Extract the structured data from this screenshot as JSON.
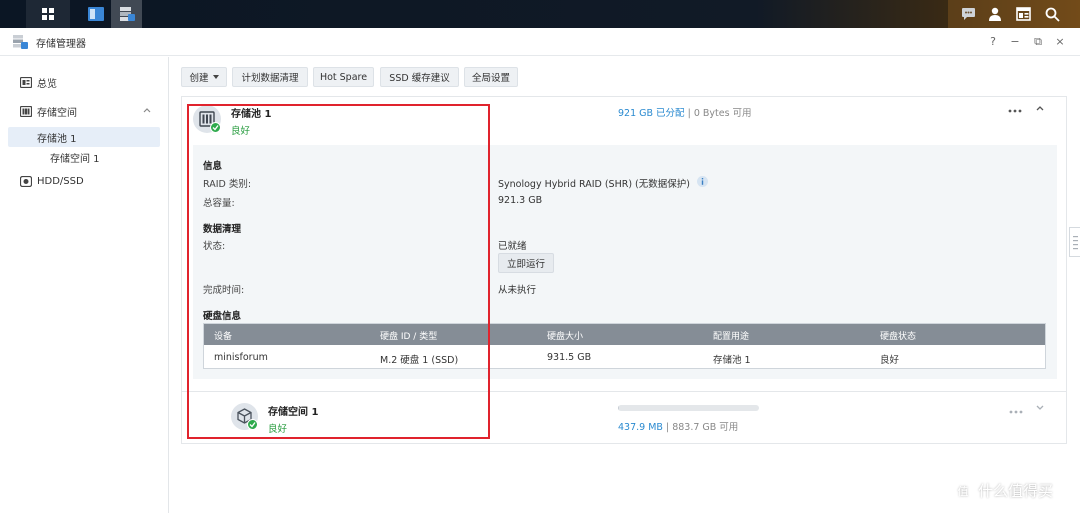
{
  "window": {
    "title": "存储管理器",
    "controls": [
      "?",
      "−",
      "⧉",
      "×"
    ]
  },
  "sidebar": {
    "items": [
      {
        "label": "总览"
      },
      {
        "label": "存储空间"
      },
      {
        "label": "存储池 1"
      },
      {
        "label": "存储空间 1"
      },
      {
        "label": "HDD/SSD"
      }
    ]
  },
  "toolbar": {
    "create_label": "创建",
    "scrub_label": "计划数据清理",
    "hotspare_label": "Hot Spare",
    "ssd_cache_label": "SSD 缓存建议",
    "global_label": "全局设置"
  },
  "pool": {
    "name": "存储池 1",
    "status": "良好",
    "allocated": "921 GB 已分配",
    "separator": " | ",
    "available": "0 Bytes 可用",
    "info_heading": "信息",
    "raid_label": "RAID 类别:",
    "raid_value": "Synology Hybrid RAID (SHR) (无数据保护)",
    "capacity_label": "总容量:",
    "capacity_value": "921.3 GB",
    "scrub_heading": "数据清理",
    "state_label": "状态:",
    "state_value": "已就绪",
    "run_now": "立即运行",
    "finish_label": "完成时间:",
    "finish_value": "从未执行",
    "disk_heading": "硬盘信息"
  },
  "disk_table": {
    "headers": [
      "设备",
      "硬盘 ID / 类型",
      "硬盘大小",
      "配置用途",
      "硬盘状态"
    ],
    "rows": [
      [
        "minisforum",
        "M.2 硬盘 1 (SSD)",
        "931.5 GB",
        "存储池 1",
        "良好"
      ]
    ]
  },
  "volume": {
    "name": "存储空间 1",
    "status": "良好",
    "used": "437.9 MB",
    "separator": " | ",
    "total": "883.7 GB 可用",
    "usage_fraction": 0.005
  },
  "watermark": {
    "text": "什么值得买",
    "symbol": "值"
  },
  "colors": {
    "accent_blue": "#2a8ad0",
    "status_green": "#239a3b",
    "highlight_red": "#e0232d"
  }
}
